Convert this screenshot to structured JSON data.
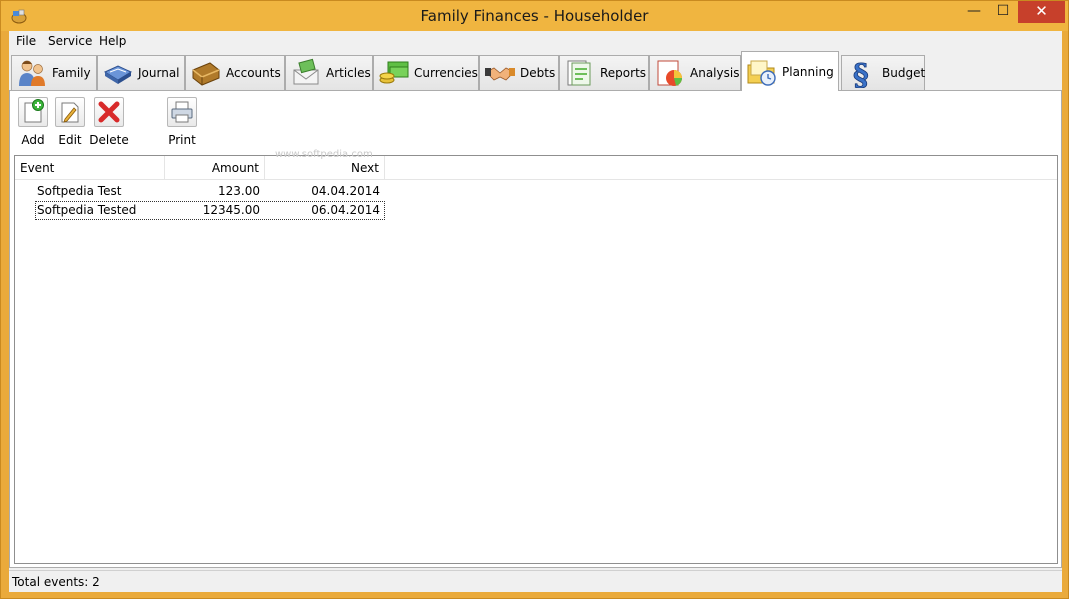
{
  "window": {
    "title": "Family Finances - Householder",
    "minimize_glyph": "—",
    "maximize_glyph": "☐",
    "close_glyph": "✕",
    "titlebar_color": "#f0b540",
    "close_color": "#c7402b"
  },
  "menu": [
    {
      "label": "File"
    },
    {
      "label": "Service"
    },
    {
      "label": "Help"
    }
  ],
  "tabs": [
    {
      "label": "Family",
      "icon": "family-icon",
      "active": false
    },
    {
      "label": "Journal",
      "icon": "journal-icon",
      "active": false
    },
    {
      "label": "Accounts",
      "icon": "wallet-icon",
      "active": false
    },
    {
      "label": "Articles",
      "icon": "articles-icon",
      "active": false
    },
    {
      "label": "Currencies",
      "icon": "currencies-icon",
      "active": false
    },
    {
      "label": "Debts",
      "icon": "handshake-icon",
      "active": false
    },
    {
      "label": "Reports",
      "icon": "reports-icon",
      "active": false
    },
    {
      "label": "Analysis",
      "icon": "analysis-icon",
      "active": false
    },
    {
      "label": "Planning",
      "icon": "planning-icon",
      "active": true
    },
    {
      "label": "Budget",
      "icon": "budget-icon",
      "active": false
    }
  ],
  "toolbar": {
    "add_label": "Add",
    "edit_label": "Edit",
    "delete_label": "Delete",
    "print_label": "Print"
  },
  "list": {
    "columns": [
      "Event",
      "Amount",
      "Next"
    ],
    "rows": [
      {
        "event": "Softpedia Test",
        "amount": "123.00",
        "next": "04.04.2014",
        "selected": false
      },
      {
        "event": "Softpedia Tested",
        "amount": "12345.00",
        "next": "06.04.2014",
        "selected": true
      }
    ]
  },
  "watermark": "www.softpedia.com",
  "status": {
    "text": "Total events: 2"
  }
}
